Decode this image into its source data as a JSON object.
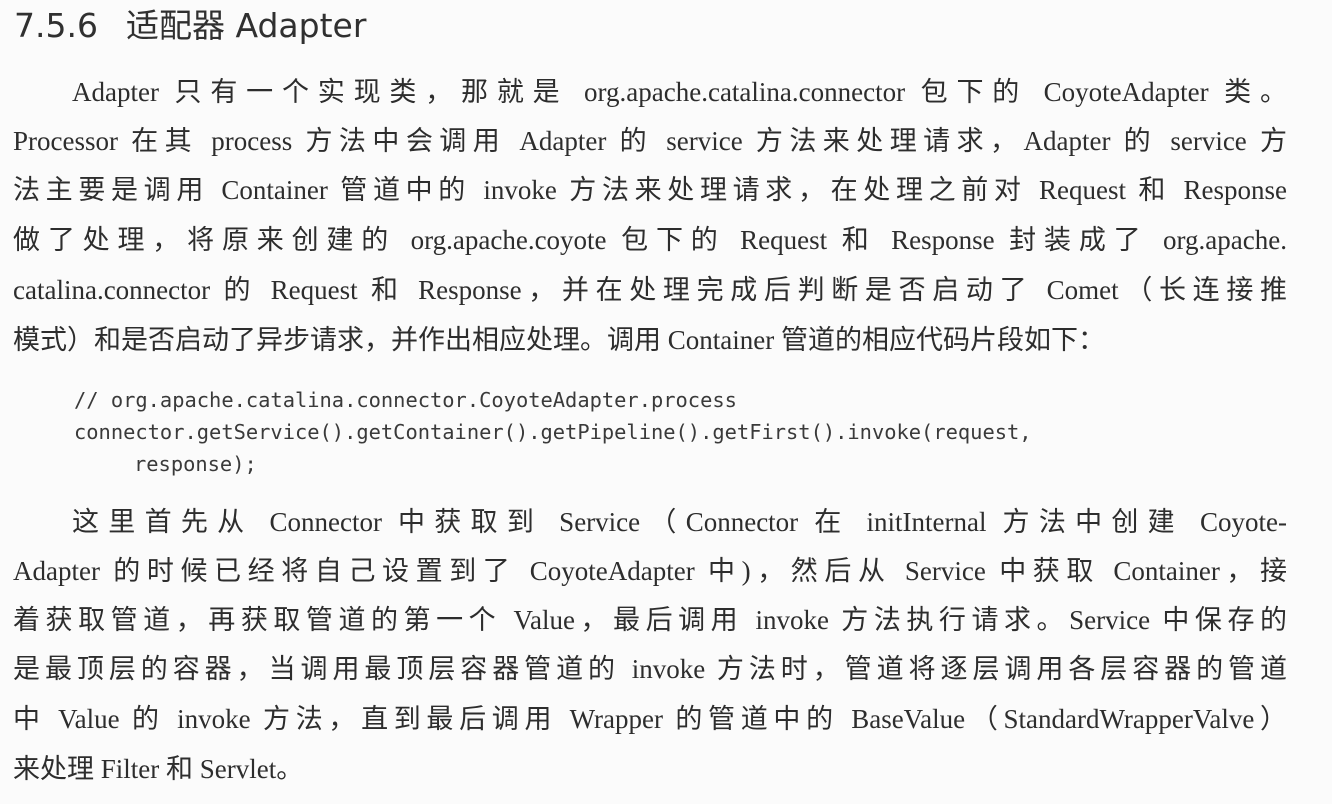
{
  "section": {
    "number": "7.5.6",
    "title": "适配器 Adapter"
  },
  "paragraph1": {
    "lines": [
      "Adapter 只有一个实现类，那就是 org.apache.catalina.connector 包下的 CoyoteAdapter 类。",
      "Processor 在其 process 方法中会调用 Adapter 的 service 方法来处理请求，Adapter 的 service 方",
      "法主要是调用 Container 管道中的 invoke 方法来处理请求，在处理之前对 Request 和 Response",
      "做了处理，将原来创建的 org.apache.coyote 包下的 Request 和 Response 封装成了 org.apache.",
      "catalina.connector 的 Request 和 Response，并在处理完成后判断是否启动了 Comet（长连接推",
      "模式）和是否启动了异步请求，并作出相应处理。调用 Container 管道的相应代码片段如下："
    ]
  },
  "code": {
    "lines": [
      "// org.apache.catalina.connector.CoyoteAdapter.process",
      "connector.getService().getContainer().getPipeline().getFirst().invoke(request,",
      "response);"
    ]
  },
  "paragraph2": {
    "lines": [
      "这里首先从 Connector 中获取到 Service（Connector 在 initInternal 方法中创建 Coyote-",
      "Adapter 的时候已经将自己设置到了 CoyoteAdapter 中)，然后从 Service 中获取 Container，接",
      "着获取管道，再获取管道的第一个 Value，最后调用 invoke 方法执行请求。Service 中保存的",
      "是最顶层的容器，当调用最顶层容器管道的 invoke 方法时，管道将逐层调用各层容器的管道",
      "中 Value 的 invoke 方法，直到最后调用 Wrapper 的管道中的 BaseValue（StandardWrapperValve）",
      "来处理 Filter 和 Servlet。"
    ]
  }
}
